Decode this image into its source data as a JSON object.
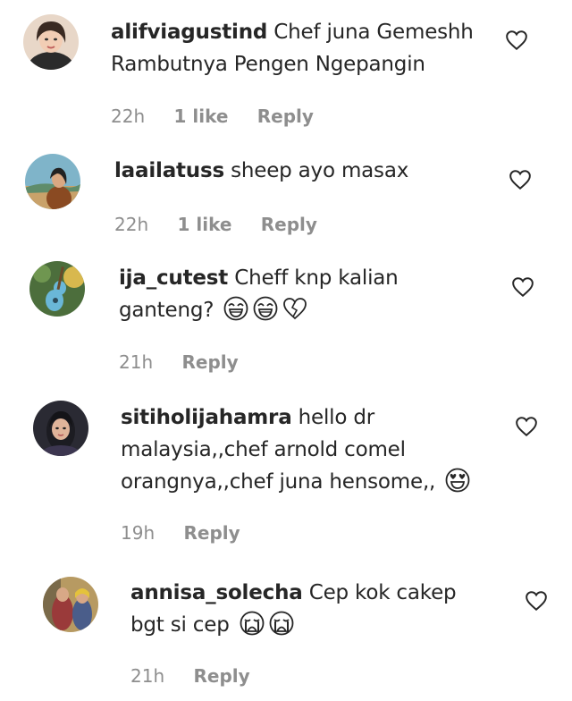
{
  "comments": [
    {
      "username": "alifviagustind",
      "text_line1": "Chef juna Gemeshh",
      "text_line2": "Rambutnya Pengen Ngepangin",
      "time": "22h",
      "likes": "1 like",
      "reply": "Reply"
    },
    {
      "username": "laailatuss",
      "text_line1": "sheep ayo masax",
      "time": "22h",
      "likes": "1 like",
      "reply": "Reply"
    },
    {
      "username": "ija_cutest",
      "text_line1": "Cheff knp kalian",
      "text_line2": "ganteng?",
      "emojis": [
        "laughing-crying-emoji",
        "laughing-crying-emoji",
        "broken-heart-emoji"
      ],
      "time": "21h",
      "reply": "Reply"
    },
    {
      "username": "sitiholijahamra",
      "text_line1": "hello dr",
      "text_line2": "malaysia,,chef arnold comel",
      "text_line3": "orangnya,,chef juna hensome,,",
      "emojis": [
        "heart-eyes-emoji"
      ],
      "time": "19h",
      "reply": "Reply"
    },
    {
      "username": "annisa_solecha",
      "text_line1": "Cep kok cakep",
      "text_line2": "bgt si cep",
      "emojis": [
        "loudly-crying-emoji",
        "loudly-crying-emoji"
      ],
      "time": "21h",
      "reply": "Reply"
    }
  ],
  "colors": {
    "text": "#262626",
    "meta": "#8e8e8e"
  }
}
